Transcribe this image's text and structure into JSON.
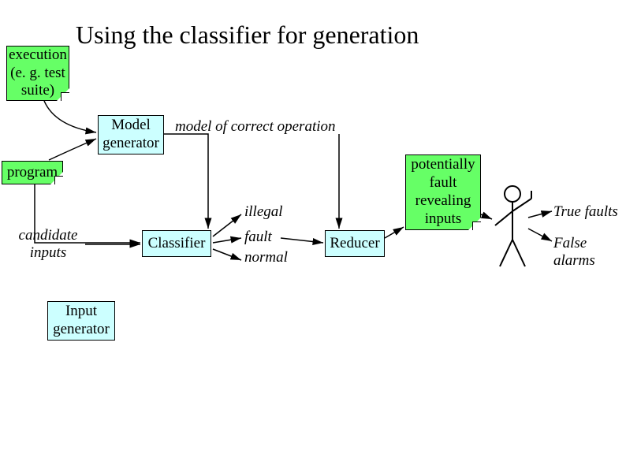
{
  "title": "Using the classifier for generation",
  "nodes": {
    "execution": {
      "l1": "execution",
      "l2": "(e. g. test",
      "l3": "suite)"
    },
    "model_generator": {
      "l1": "Model",
      "l2": "generator"
    },
    "program": "program",
    "classifier": "Classifier",
    "reducer": "Reducer",
    "potential": {
      "l1": "potentially",
      "l2": "fault",
      "l3": "revealing",
      "l4": "inputs"
    },
    "input_generator": {
      "l1": "Input",
      "l2": "generator"
    }
  },
  "labels": {
    "model_correct": "model of correct operation",
    "illegal": "illegal",
    "fault": "fault",
    "normal": "normal",
    "candidate": {
      "l1": "candidate",
      "l2": "inputs"
    },
    "true_faults": "True faults",
    "false_alarms": "False alarms"
  }
}
